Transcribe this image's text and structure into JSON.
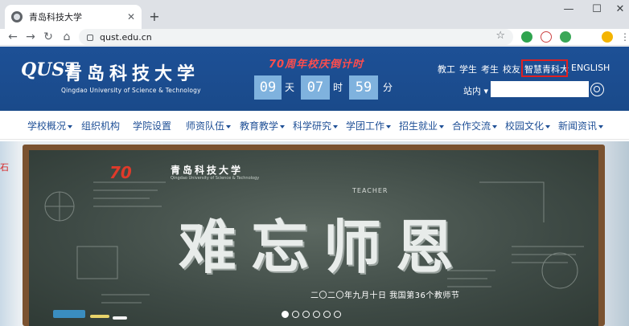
{
  "browser": {
    "tab_title": "青岛科技大学",
    "tab_close": "✕",
    "new_tab": "+",
    "window_controls": [
      "—",
      "☐",
      "✕"
    ],
    "back": "←",
    "forward": "→",
    "reload": "↻",
    "home": "⌂",
    "url": "qust.edu.cn",
    "bookmark": "☆"
  },
  "header": {
    "logo_mark": "QUST",
    "logo_cn": "青岛科技大学",
    "logo_en": "Qingdao University of Science & Technology",
    "countdown_title": "70周年校庆倒计时",
    "countdown": [
      {
        "value": "09",
        "unit": "天"
      },
      {
        "value": "07",
        "unit": "时"
      },
      {
        "value": "59",
        "unit": "分"
      }
    ],
    "top_links": [
      "教工",
      "学生",
      "考生",
      "校友",
      "智慧青科大",
      "ENGLISH"
    ],
    "search_scope": "站内 ▾",
    "search_placeholder": ""
  },
  "menu": {
    "items": [
      {
        "label": "学校概况",
        "dropdown": true
      },
      {
        "label": "组织机构",
        "dropdown": false
      },
      {
        "label": "学院设置",
        "dropdown": false
      },
      {
        "label": "师资队伍",
        "dropdown": true
      },
      {
        "label": "教育教学",
        "dropdown": true
      },
      {
        "label": "科学研究",
        "dropdown": true
      },
      {
        "label": "学团工作",
        "dropdown": true
      },
      {
        "label": "招生就业",
        "dropdown": true
      },
      {
        "label": "合作交流",
        "dropdown": true
      },
      {
        "label": "校园文化",
        "dropdown": true
      },
      {
        "label": "新闻资讯",
        "dropdown": true
      }
    ]
  },
  "banner": {
    "left_edge_text": "石",
    "badge": "70",
    "logo_cn": "青岛科技大学",
    "logo_en": "Qingdao University of Science & Technology",
    "teacher_label": "TEACHER",
    "title": "难忘师恩",
    "subtitle": "二〇二〇年九月十日  我国第36个教师节",
    "slide_count": 6,
    "active_slide": 0
  }
}
